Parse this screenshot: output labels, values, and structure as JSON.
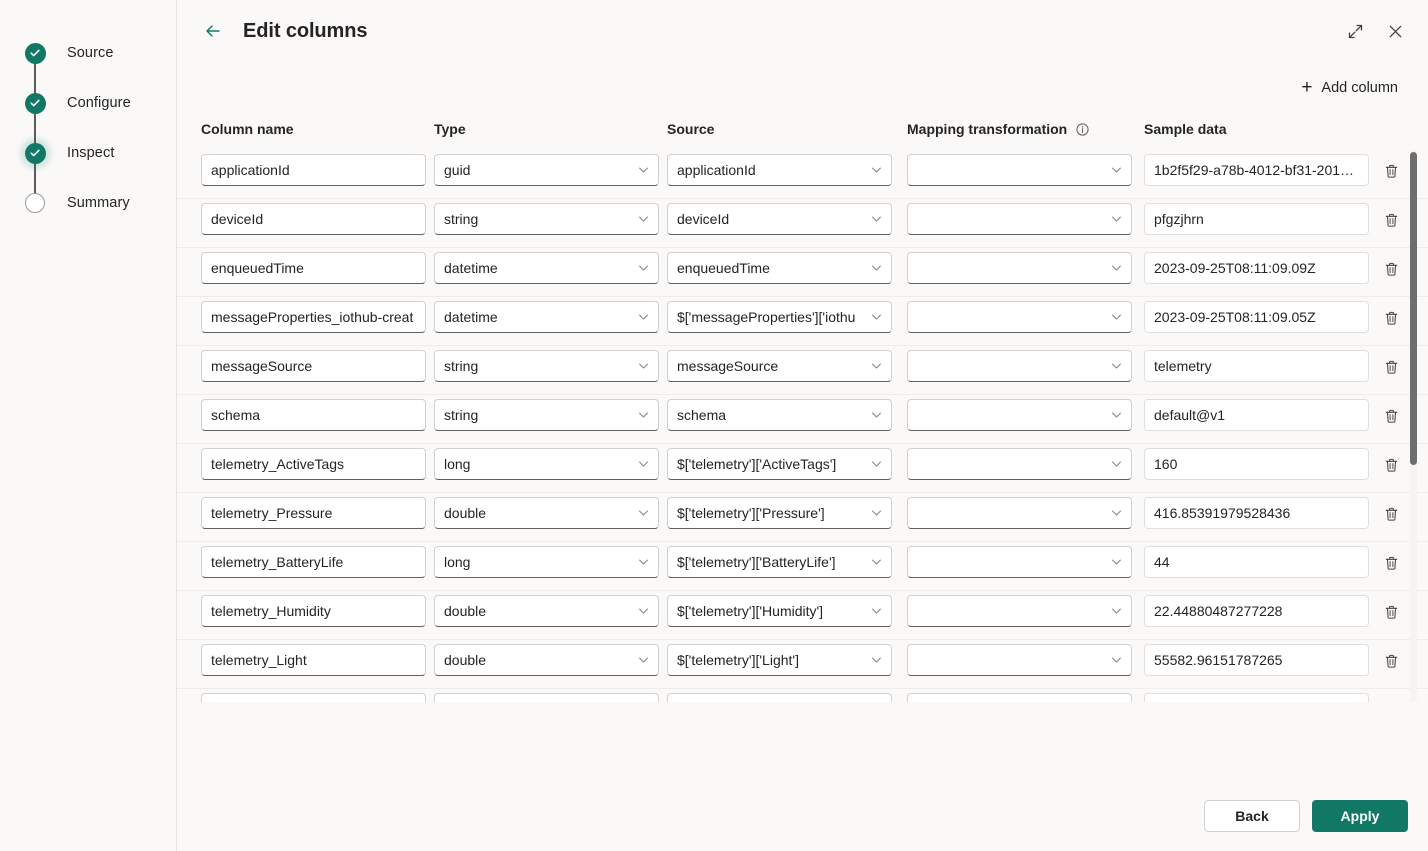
{
  "wizard": {
    "steps": [
      {
        "label": "Source",
        "state": "complete"
      },
      {
        "label": "Configure",
        "state": "complete"
      },
      {
        "label": "Inspect",
        "state": "current"
      },
      {
        "label": "Summary",
        "state": "pending"
      }
    ]
  },
  "header": {
    "title": "Edit columns",
    "back_icon": "arrow-left-icon",
    "expand_icon": "expand-diagonal-icon",
    "close_icon": "close-icon"
  },
  "toolbar": {
    "add_column_label": "Add column",
    "add_column_icon": "plus-icon"
  },
  "grid": {
    "headers": {
      "column_name": "Column name",
      "type": "Type",
      "source": "Source",
      "mapping_transformation": "Mapping transformation",
      "mapping_info_icon": "info-icon",
      "sample_data": "Sample data"
    },
    "rows": [
      {
        "column_name": "applicationId",
        "type": "guid",
        "source": "applicationId",
        "mapping_transformation": "",
        "sample_data": "1b2f5f29-a78b-4012-bf31-201…"
      },
      {
        "column_name": "deviceId",
        "type": "string",
        "source": "deviceId",
        "mapping_transformation": "",
        "sample_data": "pfgzjhrn"
      },
      {
        "column_name": "enqueuedTime",
        "type": "datetime",
        "source": "enqueuedTime",
        "mapping_transformation": "",
        "sample_data": "2023-09-25T08:11:09.09Z"
      },
      {
        "column_name": "messageProperties_iothub-creat",
        "type": "datetime",
        "source": "$['messageProperties']['iothu",
        "mapping_transformation": "",
        "sample_data": "2023-09-25T08:11:09.05Z"
      },
      {
        "column_name": "messageSource",
        "type": "string",
        "source": "messageSource",
        "mapping_transformation": "",
        "sample_data": "telemetry"
      },
      {
        "column_name": "schema",
        "type": "string",
        "source": "schema",
        "mapping_transformation": "",
        "sample_data": "default@v1"
      },
      {
        "column_name": "telemetry_ActiveTags",
        "type": "long",
        "source": "$['telemetry']['ActiveTags']",
        "mapping_transformation": "",
        "sample_data": "160"
      },
      {
        "column_name": "telemetry_Pressure",
        "type": "double",
        "source": "$['telemetry']['Pressure']",
        "mapping_transformation": "",
        "sample_data": "416.85391979528436"
      },
      {
        "column_name": "telemetry_BatteryLife",
        "type": "long",
        "source": "$['telemetry']['BatteryLife']",
        "mapping_transformation": "",
        "sample_data": "44"
      },
      {
        "column_name": "telemetry_Humidity",
        "type": "double",
        "source": "$['telemetry']['Humidity']",
        "mapping_transformation": "",
        "sample_data": "22.44880487277228"
      },
      {
        "column_name": "telemetry_Light",
        "type": "double",
        "source": "$['telemetry']['Light']",
        "mapping_transformation": "",
        "sample_data": "55582.96151787265"
      },
      {
        "column_name": "",
        "type": "",
        "source": "",
        "mapping_transformation": "",
        "sample_data": ""
      }
    ],
    "delete_icon": "trash-icon",
    "dropdown_icon": "chevron-down-icon"
  },
  "footer": {
    "back_label": "Back",
    "apply_label": "Apply"
  },
  "colors": {
    "accent": "#117865",
    "page_bg": "#faf9f8",
    "field_bg": "#ffffff",
    "text": "#242424"
  }
}
